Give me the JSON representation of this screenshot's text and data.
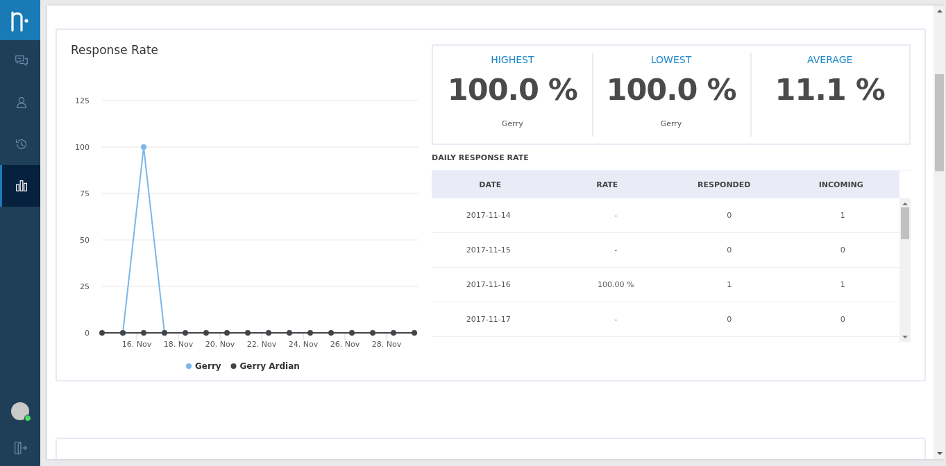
{
  "sidebar": {
    "items": [
      {
        "kind": "chat",
        "selected": false
      },
      {
        "kind": "agent",
        "selected": false
      },
      {
        "kind": "history",
        "selected": false
      },
      {
        "kind": "reports",
        "selected": true
      }
    ],
    "user_online": true
  },
  "card": {
    "title": "Response Rate",
    "chart_data": {
      "type": "line",
      "categories": [
        null,
        null,
        "16. Nov",
        null,
        "18. Nov",
        null,
        "20. Nov",
        null,
        "22. Nov",
        null,
        "24. Nov",
        null,
        "26. Nov",
        null,
        "28. Nov",
        null
      ],
      "ylim": [
        0,
        125
      ],
      "yticks": [
        0,
        25,
        50,
        75,
        100,
        125
      ],
      "grid": {
        "y": true
      },
      "legend": true,
      "series": [
        {
          "name": "Gerry",
          "color": "#7cb5ec",
          "marker": "circle",
          "values": [
            null,
            0,
            100,
            0,
            null,
            null,
            null,
            null,
            null,
            null,
            null,
            null,
            null,
            null,
            null,
            null
          ]
        },
        {
          "name": "Gerry Ardian",
          "color": "#434348",
          "marker": "circle",
          "values": [
            0,
            0,
            0,
            0,
            0,
            0,
            0,
            0,
            0,
            0,
            0,
            0,
            0,
            0,
            0,
            0
          ]
        }
      ]
    },
    "stats": [
      {
        "label": "HIGHEST",
        "value": "100.0 %",
        "agent": "Gerry"
      },
      {
        "label": "LOWEST",
        "value": "100.0 %",
        "agent": "Gerry"
      },
      {
        "label": "AVERAGE",
        "value": "11.1 %"
      }
    ],
    "table": {
      "title": "DAILY RESPONSE RATE",
      "columns": [
        "DATE",
        "RATE",
        "RESPONDED",
        "INCOMING"
      ],
      "rows": [
        [
          "2017-11-14",
          "-",
          "0",
          "1"
        ],
        [
          "2017-11-15",
          "-",
          "0",
          "0"
        ],
        [
          "2017-11-16",
          "100.00 %",
          "1",
          "1"
        ],
        [
          "2017-11-17",
          "-",
          "0",
          "0"
        ]
      ]
    }
  }
}
